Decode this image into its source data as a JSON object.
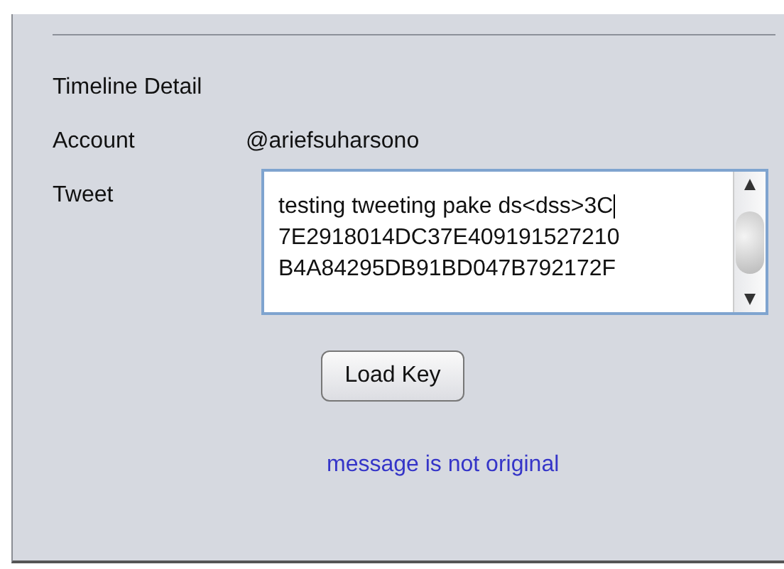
{
  "section_title": "Timeline Detail",
  "fields": [
    {
      "label": "Account",
      "kind": "text",
      "value": "@ariefsuharsono"
    },
    {
      "label": "Tweet",
      "kind": "textarea",
      "lines": [
        "testing tweeting pake ds<dss>3C",
        "7E2918014DC37E409191527210",
        "B4A84295DB91BD047B792172F"
      ]
    }
  ],
  "button": "Load Key",
  "status": "message is not original"
}
